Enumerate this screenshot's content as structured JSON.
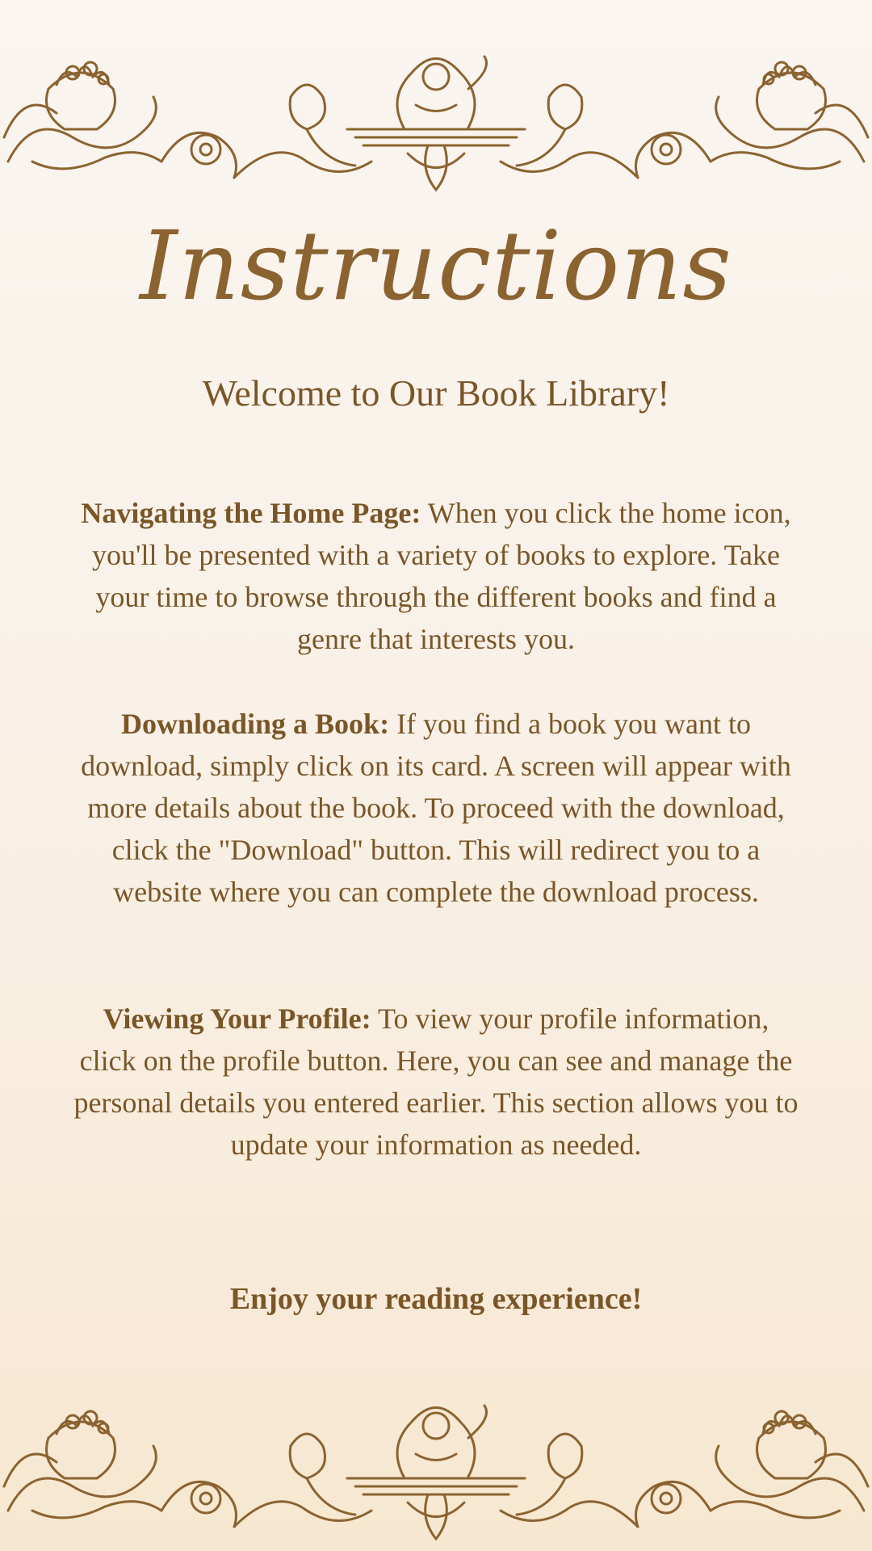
{
  "page": {
    "title": "Instructions",
    "subtitle": "Welcome to Our Book Library!",
    "sections": [
      {
        "heading": "Navigating the Home Page:",
        "body": " When you click the home icon, you'll be presented with a variety of books to explore. Take your time to browse through the different books and find a genre that interests you."
      },
      {
        "heading": "Downloading a Book:",
        "body": " If you find a book you want to download, simply click on its card. A screen will appear with more details about the book. To proceed with the download, click the \"Download\" button. This will redirect you to a website where you can complete the download process."
      },
      {
        "heading": "Viewing Your Profile:",
        "body": " To view your profile information, click on the profile button. Here, you can see and manage the personal details you entered earlier. This section allows you to update your information as needed."
      }
    ],
    "closing": "Enjoy your reading experience!"
  },
  "ornaments": {
    "top": "baroque-cherub-ornament-icon",
    "bottom": "baroque-cherub-ornament-icon"
  },
  "colors": {
    "ink": "#7a5526",
    "ornament": "#8b6330",
    "background": "#faf5f0"
  }
}
